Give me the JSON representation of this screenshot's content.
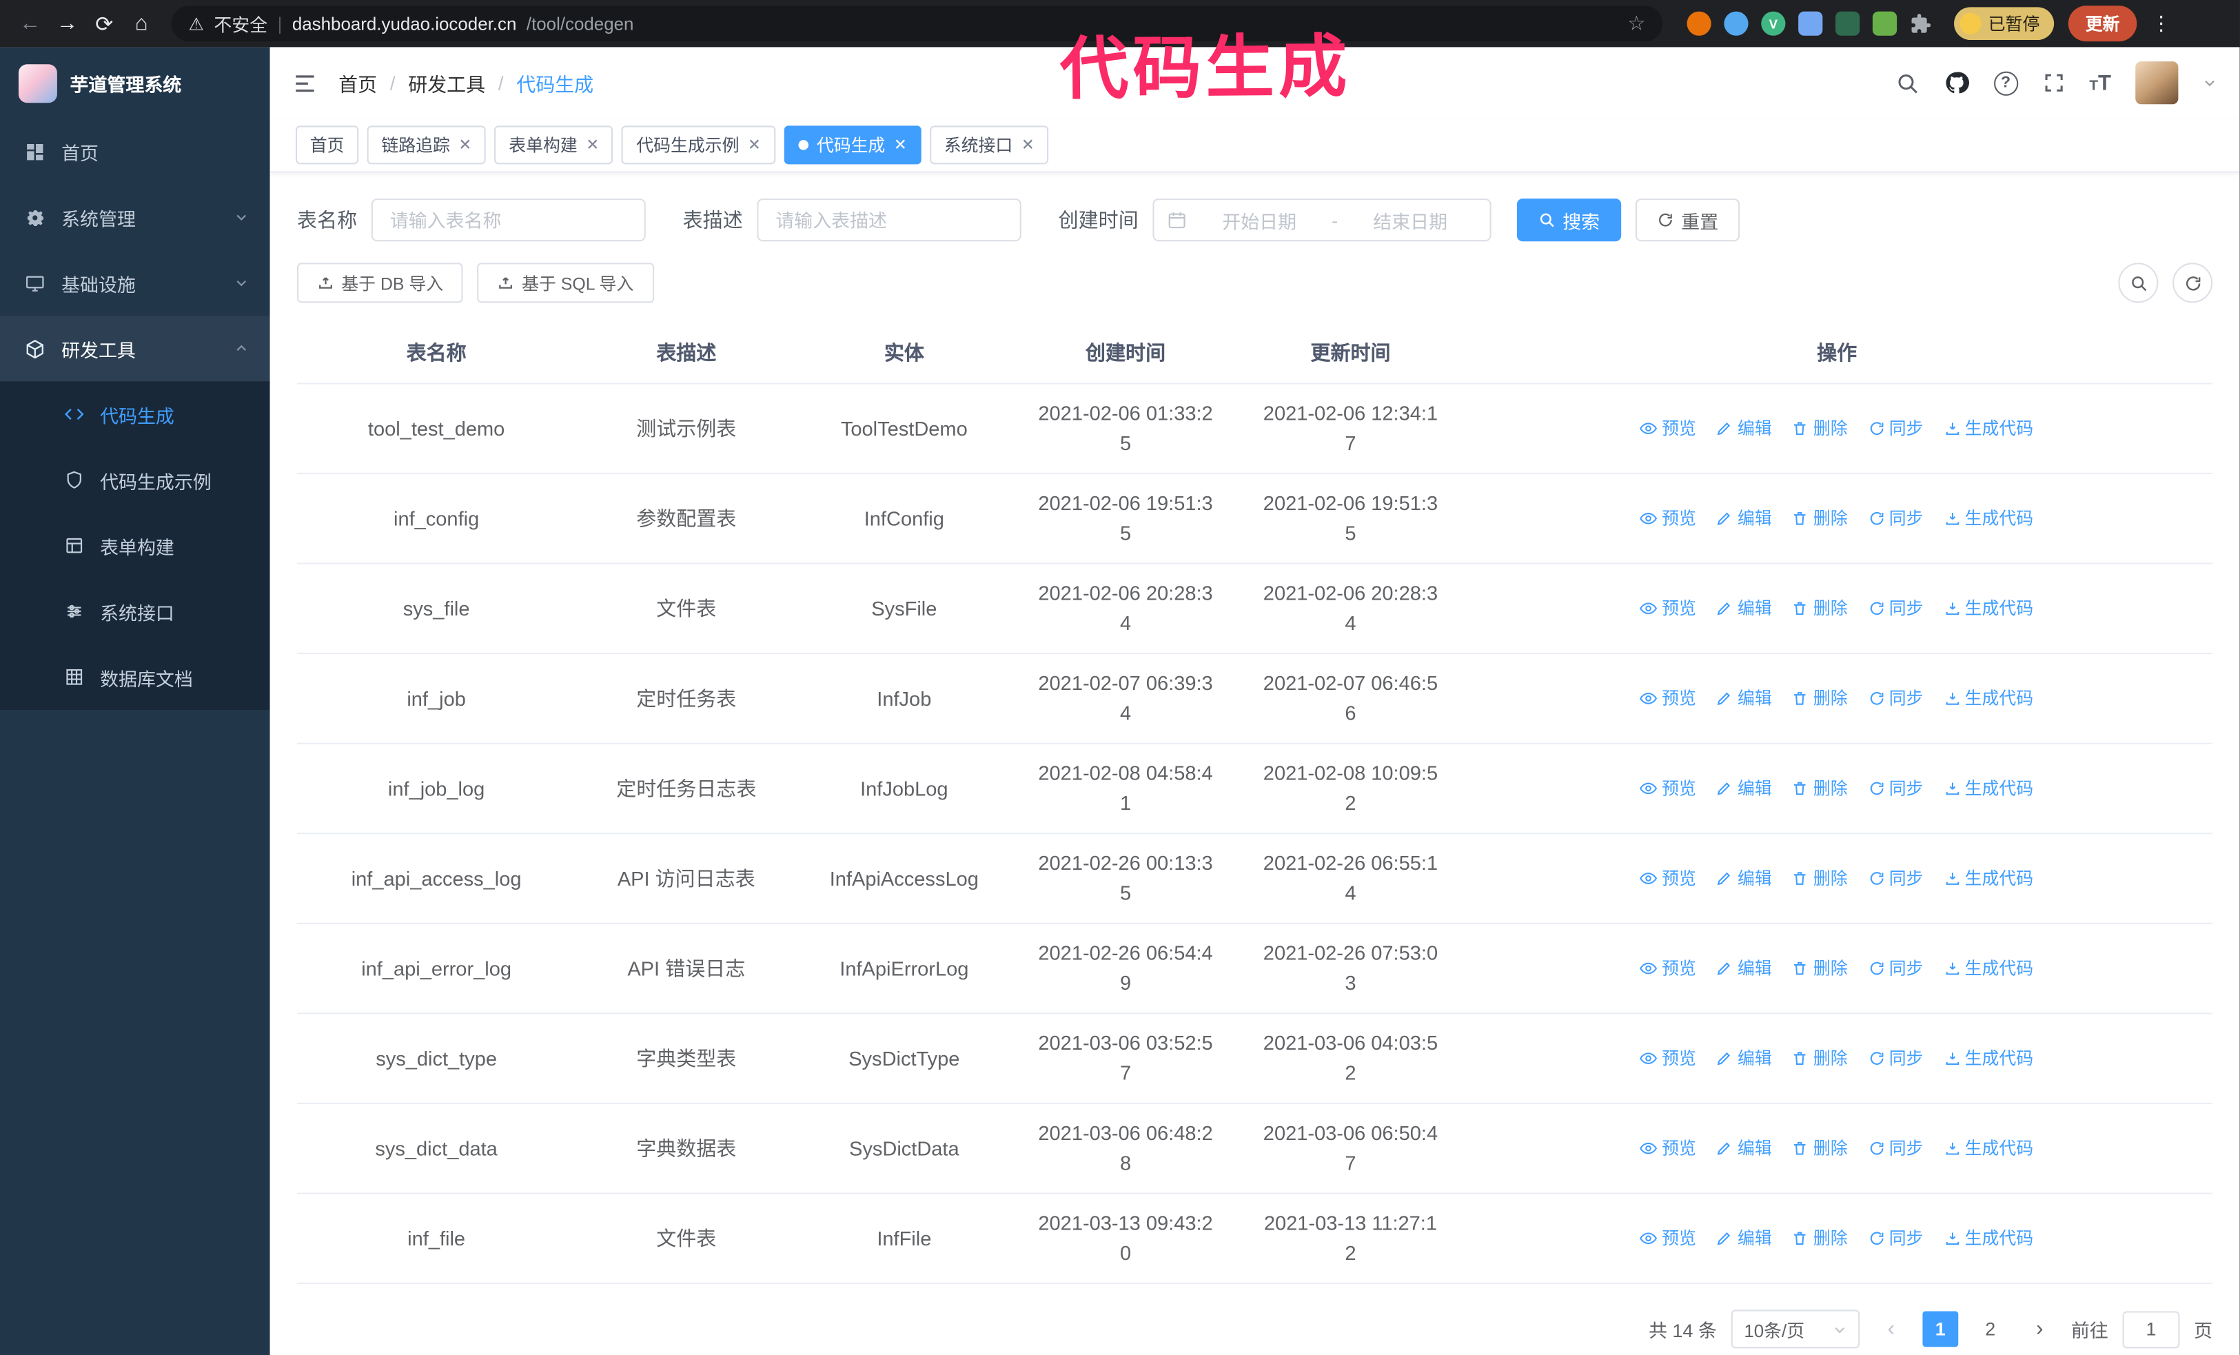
{
  "annotation": {
    "text": "代码生成",
    "color": "#fa2b66"
  },
  "browser": {
    "security_label": "不安全",
    "url_host": "dashboard.yudao.iocoder.cn",
    "url_path": "/tool/codegen",
    "profile_status": "已暂停",
    "update_label": "更新"
  },
  "sidebar": {
    "logo_title": "芋道管理系统",
    "items": [
      {
        "label": "首页"
      },
      {
        "label": "系统管理"
      },
      {
        "label": "基础设施"
      },
      {
        "label": "研发工具"
      }
    ],
    "submenu": [
      {
        "label": "代码生成"
      },
      {
        "label": "代码生成示例"
      },
      {
        "label": "表单构建"
      },
      {
        "label": "系统接口"
      },
      {
        "label": "数据库文档"
      }
    ]
  },
  "header": {
    "breadcrumb": [
      "首页",
      "研发工具",
      "代码生成"
    ]
  },
  "tabs": [
    {
      "label": "首页"
    },
    {
      "label": "链路追踪"
    },
    {
      "label": "表单构建"
    },
    {
      "label": "代码生成示例"
    },
    {
      "label": "代码生成"
    },
    {
      "label": "系统接口"
    }
  ],
  "filters": {
    "name_label": "表名称",
    "name_placeholder": "请输入表名称",
    "desc_label": "表描述",
    "desc_placeholder": "请输入表描述",
    "time_label": "创建时间",
    "start_placeholder": "开始日期",
    "range_separator": "-",
    "end_placeholder": "结束日期",
    "search_button": "搜索",
    "reset_button": "重置"
  },
  "toolbar": {
    "import_db": "基于 DB 导入",
    "import_sql": "基于 SQL 导入"
  },
  "table": {
    "columns": [
      "表名称",
      "表描述",
      "实体",
      "创建时间",
      "更新时间",
      "操作"
    ],
    "actions": [
      "预览",
      "编辑",
      "删除",
      "同步",
      "生成代码"
    ],
    "rows": [
      {
        "name": "tool_test_demo",
        "desc": "测试示例表",
        "entity": "ToolTestDemo",
        "created": "2021-02-06 01:33:25",
        "updated": "2021-02-06 12:34:17"
      },
      {
        "name": "inf_config",
        "desc": "参数配置表",
        "entity": "InfConfig",
        "created": "2021-02-06 19:51:35",
        "updated": "2021-02-06 19:51:35"
      },
      {
        "name": "sys_file",
        "desc": "文件表",
        "entity": "SysFile",
        "created": "2021-02-06 20:28:34",
        "updated": "2021-02-06 20:28:34"
      },
      {
        "name": "inf_job",
        "desc": "定时任务表",
        "entity": "InfJob",
        "created": "2021-02-07 06:39:34",
        "updated": "2021-02-07 06:46:56"
      },
      {
        "name": "inf_job_log",
        "desc": "定时任务日志表",
        "entity": "InfJobLog",
        "created": "2021-02-08 04:58:41",
        "updated": "2021-02-08 10:09:52"
      },
      {
        "name": "inf_api_access_log",
        "desc": "API 访问日志表",
        "entity": "InfApiAccessLog",
        "created": "2021-02-26 00:13:35",
        "updated": "2021-02-26 06:55:14"
      },
      {
        "name": "inf_api_error_log",
        "desc": "API 错误日志",
        "entity": "InfApiErrorLog",
        "created": "2021-02-26 06:54:49",
        "updated": "2021-02-26 07:53:03"
      },
      {
        "name": "sys_dict_type",
        "desc": "字典类型表",
        "entity": "SysDictType",
        "created": "2021-03-06 03:52:57",
        "updated": "2021-03-06 04:03:52"
      },
      {
        "name": "sys_dict_data",
        "desc": "字典数据表",
        "entity": "SysDictData",
        "created": "2021-03-06 06:48:28",
        "updated": "2021-03-06 06:50:47"
      },
      {
        "name": "inf_file",
        "desc": "文件表",
        "entity": "InfFile",
        "created": "2021-03-13 09:43:20",
        "updated": "2021-03-13 11:27:12"
      }
    ]
  },
  "pagination": {
    "total": "共 14 条",
    "page_size": "10条/页",
    "pages": [
      "1",
      "2"
    ],
    "goto_label": "前往",
    "goto_value": "1",
    "goto_suffix": "页"
  }
}
